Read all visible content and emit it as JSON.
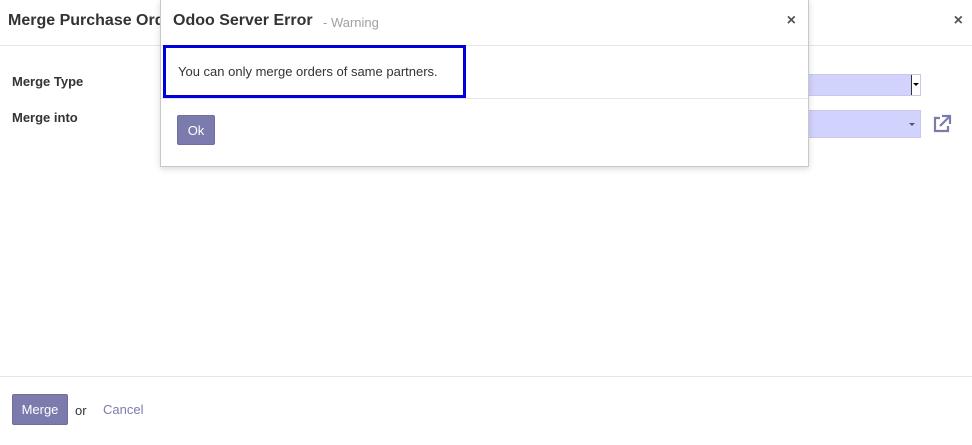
{
  "background_dialog": {
    "title": "Merge Purchase Ord",
    "close_glyph": "×",
    "fields": {
      "merge_type_label": "Merge Type",
      "merge_into_label": "Merge into"
    },
    "external_link_icon": "external-link-icon",
    "footer": {
      "merge_label": "Merge",
      "or_text": "or",
      "cancel_label": "Cancel"
    }
  },
  "error_modal": {
    "title": "Odoo Server Error",
    "subtitle": "- Warning",
    "close_glyph": "×",
    "message": "You can only merge orders of same partners.",
    "ok_label": "Ok"
  },
  "colors": {
    "primary": "#7c7bad",
    "select_bg": "#d2d2ff",
    "highlight_border": "#0000dd"
  }
}
